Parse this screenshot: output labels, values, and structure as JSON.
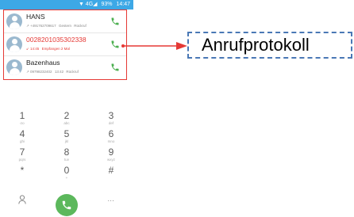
{
  "status_bar": {
    "signal": "▼ 4G◢",
    "battery": "93%",
    "time": "14:47"
  },
  "call_log": [
    {
      "name": "HANS",
      "missed": false,
      "details": [
        "↗ +491762709617",
        "Gestern",
        "Rückruf"
      ]
    },
    {
      "name": "0028201035302338",
      "missed": true,
      "details": [
        "↙ 14:45",
        "Empfangen 2 Mal"
      ]
    },
    {
      "name": "Bazenhaus",
      "missed": false,
      "details": [
        "↗ 09798232402",
        "13:42",
        "Rückruf"
      ]
    }
  ],
  "keypad": [
    [
      {
        "num": "1",
        "letters": "σο"
      },
      {
        "num": "2",
        "letters": "abc"
      },
      {
        "num": "3",
        "letters": "def"
      }
    ],
    [
      {
        "num": "4",
        "letters": "ghi"
      },
      {
        "num": "5",
        "letters": "jkl"
      },
      {
        "num": "6",
        "letters": "mno"
      }
    ],
    [
      {
        "num": "7",
        "letters": "pqrs"
      },
      {
        "num": "8",
        "letters": "tuv"
      },
      {
        "num": "9",
        "letters": "wxyz"
      }
    ],
    [
      {
        "num": "*",
        "letters": ""
      },
      {
        "num": "0",
        "letters": "+"
      },
      {
        "num": "#",
        "letters": ""
      }
    ]
  ],
  "bottom_bar": {
    "left_icon": "contacts-icon",
    "center_icon": "phone-icon",
    "right_icon": "more-icon",
    "right_label": "…",
    "dial_color": "#5cb85c"
  },
  "annotation": {
    "label": "Anrufprotokoll",
    "border_color": "#4a78b5",
    "arrow_color": "#e53935"
  },
  "colors": {
    "status_bar": "#3da8e6",
    "missed": "#e53935",
    "call_icon": "#4caf50"
  }
}
